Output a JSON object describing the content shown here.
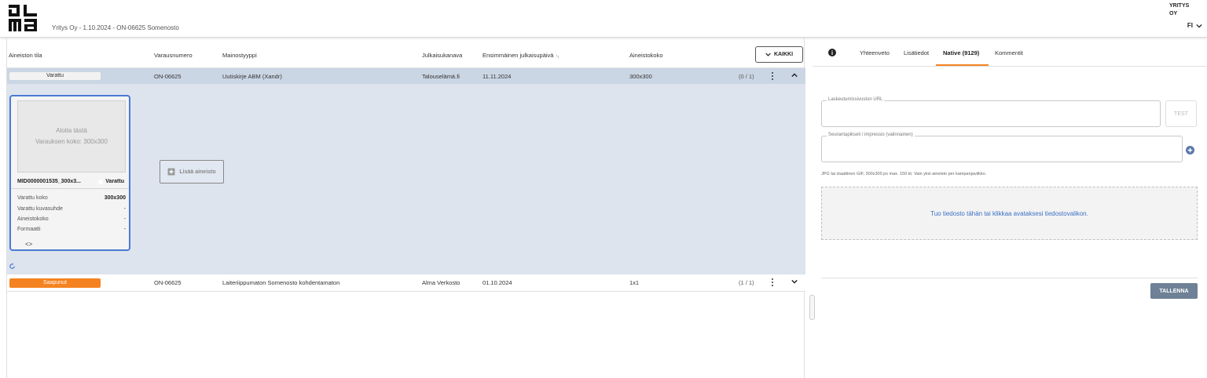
{
  "header": {
    "logo_alt": "alma",
    "subtitle": "Yritys Oy - 1.10.2024 - ON-06625 Somenosto",
    "company": "YRITYS OY",
    "language": "FI"
  },
  "table": {
    "headers": {
      "status": "Aineiston tila",
      "reservation": "Varausnumero",
      "ad_type": "Mainostyyppi",
      "channel": "Julkaisukanava",
      "first_date": "Ensimmäinen julkaisupäivä",
      "size": "Aineistokoko"
    },
    "sort_indicator": "↑₁",
    "filter_button": "KAIKKI",
    "rows": [
      {
        "status": "Varattu",
        "reservation": "ON-06625",
        "ad_type": "Uutiskirje ABM (Xandr)",
        "channel": "Talouselämä.fi",
        "first_date": "11.11.2024",
        "size": "300x300",
        "count": "(0 / 1)"
      },
      {
        "status": "Saapunut",
        "reservation": "ON-06625",
        "ad_type": "Laiteriippumaton Somenosto kohdentamaton",
        "channel": "Alma Verkosto",
        "first_date": "01.10.2024",
        "size": "1x1",
        "count": "(1 / 1)"
      }
    ]
  },
  "card": {
    "preview_line1": "Aloita tästä",
    "preview_line2": "Varauksen koko: 300x300",
    "name": "MID0000001535_300x3...",
    "status": "Varattu",
    "fields": [
      {
        "label": "Varattu koko",
        "value": "300x300"
      },
      {
        "label": "Varattu kuvasuhde",
        "value": "-"
      },
      {
        "label": "Aineistokoko",
        "value": "-"
      },
      {
        "label": "Formaatti",
        "value": "-"
      }
    ],
    "nav": "<>"
  },
  "add_material_label": "Lisää aineisto",
  "panel": {
    "tabs": [
      {
        "label": "Yhteenveto",
        "active": false
      },
      {
        "label": "Lisätiedot",
        "active": false
      },
      {
        "label": "Native (9129)",
        "active": true
      },
      {
        "label": "Kommentit",
        "active": false
      }
    ],
    "landing_url_label": "Laskeutumissivuston URL",
    "landing_url_value": "",
    "test_label": "TEST",
    "tracking_label": "Seurantapikseli / impressio (valinnainen)",
    "tracking_value": "",
    "hint": "JPG tai staattinen GIF, 300x300 px max. 150 kt. Vain yksi aineisto per kampanjaviikko.",
    "dropzone": "Tuo tiedosto tähän tai klikkaa avataksesi tiedostovalikon.",
    "save_label": "TALLENNA"
  },
  "colors": {
    "accent_orange": "#f58220",
    "row_selected": "#cbd6e4",
    "expand_bg": "#dde4ee",
    "card_border": "#4a7bd4",
    "link_blue": "#3b6fc5",
    "save_button": "#6e8196"
  }
}
